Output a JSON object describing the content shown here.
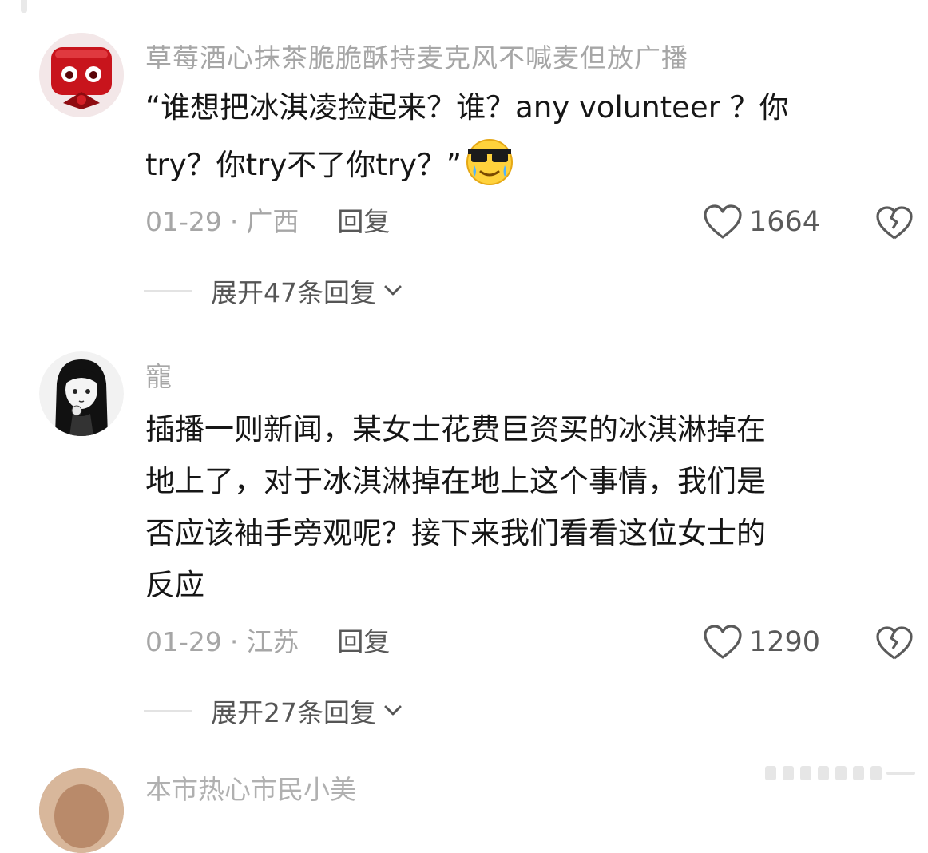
{
  "comments": [
    {
      "username": "草莓酒心抹茶脆脆酥持麦克风不喊麦但放广播",
      "text_lines": [
        "“谁想把冰淇凌捡起来？谁？any volunteer ？你",
        "try？你try不了你try？”"
      ],
      "emoji": "cool-sunglasses-emoji",
      "date": "01-29",
      "separator": "·",
      "location": "广西",
      "reply_label": "回复",
      "likes": "1664",
      "expand_label": "展开47条回复"
    },
    {
      "username": "寵",
      "text_lines": [
        "插播一则新闻，某女士花费巨资买的冰淇淋掉在",
        "地上了，对于冰淇淋掉在地上这个事情，我们是",
        "否应该袖手旁观呢？接下来我们看看这位女士的",
        "反应"
      ],
      "date": "01-29",
      "separator": "·",
      "location": "江苏",
      "reply_label": "回复",
      "likes": "1290",
      "expand_label": "展开27条回复"
    }
  ],
  "next_comment": {
    "username_partial": "本市热心市民小美"
  },
  "colors": {
    "text": "#161616",
    "meta": "#a6a6a6",
    "accent_avatar": "#c8141c"
  }
}
